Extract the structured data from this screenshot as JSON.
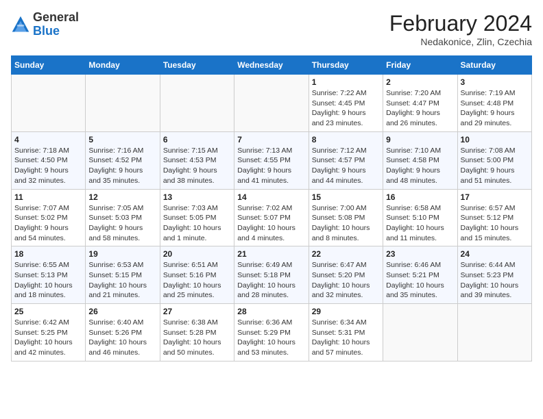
{
  "header": {
    "logo": {
      "general": "General",
      "blue": "Blue"
    },
    "title": "February 2024",
    "subtitle": "Nedakonice, Zlin, Czechia"
  },
  "columns": [
    "Sunday",
    "Monday",
    "Tuesday",
    "Wednesday",
    "Thursday",
    "Friday",
    "Saturday"
  ],
  "weeks": [
    [
      {
        "day": "",
        "info": ""
      },
      {
        "day": "",
        "info": ""
      },
      {
        "day": "",
        "info": ""
      },
      {
        "day": "",
        "info": ""
      },
      {
        "day": "1",
        "info": "Sunrise: 7:22 AM\nSunset: 4:45 PM\nDaylight: 9 hours\nand 23 minutes."
      },
      {
        "day": "2",
        "info": "Sunrise: 7:20 AM\nSunset: 4:47 PM\nDaylight: 9 hours\nand 26 minutes."
      },
      {
        "day": "3",
        "info": "Sunrise: 7:19 AM\nSunset: 4:48 PM\nDaylight: 9 hours\nand 29 minutes."
      }
    ],
    [
      {
        "day": "4",
        "info": "Sunrise: 7:18 AM\nSunset: 4:50 PM\nDaylight: 9 hours\nand 32 minutes."
      },
      {
        "day": "5",
        "info": "Sunrise: 7:16 AM\nSunset: 4:52 PM\nDaylight: 9 hours\nand 35 minutes."
      },
      {
        "day": "6",
        "info": "Sunrise: 7:15 AM\nSunset: 4:53 PM\nDaylight: 9 hours\nand 38 minutes."
      },
      {
        "day": "7",
        "info": "Sunrise: 7:13 AM\nSunset: 4:55 PM\nDaylight: 9 hours\nand 41 minutes."
      },
      {
        "day": "8",
        "info": "Sunrise: 7:12 AM\nSunset: 4:57 PM\nDaylight: 9 hours\nand 44 minutes."
      },
      {
        "day": "9",
        "info": "Sunrise: 7:10 AM\nSunset: 4:58 PM\nDaylight: 9 hours\nand 48 minutes."
      },
      {
        "day": "10",
        "info": "Sunrise: 7:08 AM\nSunset: 5:00 PM\nDaylight: 9 hours\nand 51 minutes."
      }
    ],
    [
      {
        "day": "11",
        "info": "Sunrise: 7:07 AM\nSunset: 5:02 PM\nDaylight: 9 hours\nand 54 minutes."
      },
      {
        "day": "12",
        "info": "Sunrise: 7:05 AM\nSunset: 5:03 PM\nDaylight: 9 hours\nand 58 minutes."
      },
      {
        "day": "13",
        "info": "Sunrise: 7:03 AM\nSunset: 5:05 PM\nDaylight: 10 hours\nand 1 minute."
      },
      {
        "day": "14",
        "info": "Sunrise: 7:02 AM\nSunset: 5:07 PM\nDaylight: 10 hours\nand 4 minutes."
      },
      {
        "day": "15",
        "info": "Sunrise: 7:00 AM\nSunset: 5:08 PM\nDaylight: 10 hours\nand 8 minutes."
      },
      {
        "day": "16",
        "info": "Sunrise: 6:58 AM\nSunset: 5:10 PM\nDaylight: 10 hours\nand 11 minutes."
      },
      {
        "day": "17",
        "info": "Sunrise: 6:57 AM\nSunset: 5:12 PM\nDaylight: 10 hours\nand 15 minutes."
      }
    ],
    [
      {
        "day": "18",
        "info": "Sunrise: 6:55 AM\nSunset: 5:13 PM\nDaylight: 10 hours\nand 18 minutes."
      },
      {
        "day": "19",
        "info": "Sunrise: 6:53 AM\nSunset: 5:15 PM\nDaylight: 10 hours\nand 21 minutes."
      },
      {
        "day": "20",
        "info": "Sunrise: 6:51 AM\nSunset: 5:16 PM\nDaylight: 10 hours\nand 25 minutes."
      },
      {
        "day": "21",
        "info": "Sunrise: 6:49 AM\nSunset: 5:18 PM\nDaylight: 10 hours\nand 28 minutes."
      },
      {
        "day": "22",
        "info": "Sunrise: 6:47 AM\nSunset: 5:20 PM\nDaylight: 10 hours\nand 32 minutes."
      },
      {
        "day": "23",
        "info": "Sunrise: 6:46 AM\nSunset: 5:21 PM\nDaylight: 10 hours\nand 35 minutes."
      },
      {
        "day": "24",
        "info": "Sunrise: 6:44 AM\nSunset: 5:23 PM\nDaylight: 10 hours\nand 39 minutes."
      }
    ],
    [
      {
        "day": "25",
        "info": "Sunrise: 6:42 AM\nSunset: 5:25 PM\nDaylight: 10 hours\nand 42 minutes."
      },
      {
        "day": "26",
        "info": "Sunrise: 6:40 AM\nSunset: 5:26 PM\nDaylight: 10 hours\nand 46 minutes."
      },
      {
        "day": "27",
        "info": "Sunrise: 6:38 AM\nSunset: 5:28 PM\nDaylight: 10 hours\nand 50 minutes."
      },
      {
        "day": "28",
        "info": "Sunrise: 6:36 AM\nSunset: 5:29 PM\nDaylight: 10 hours\nand 53 minutes."
      },
      {
        "day": "29",
        "info": "Sunrise: 6:34 AM\nSunset: 5:31 PM\nDaylight: 10 hours\nand 57 minutes."
      },
      {
        "day": "",
        "info": ""
      },
      {
        "day": "",
        "info": ""
      }
    ]
  ]
}
